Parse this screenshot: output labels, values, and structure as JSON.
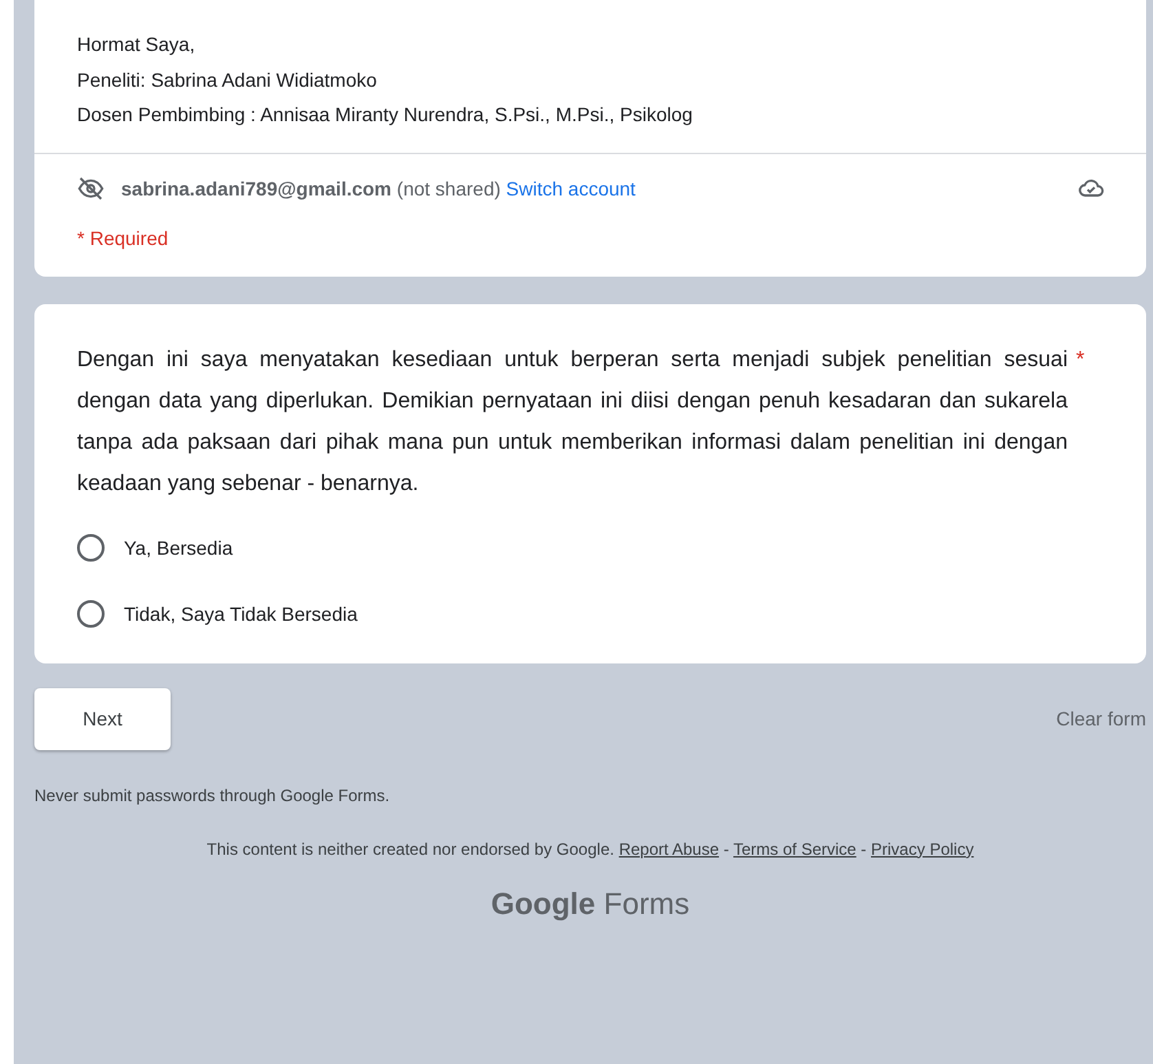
{
  "intro_card": {
    "lines": [
      "Hormat Saya,",
      "Peneliti: Sabrina Adani Widiatmoko",
      "Dosen Pembimbing : Annisaa Miranty Nurendra, S.Psi., M.Psi., Psikolog"
    ],
    "account": {
      "email": "sabrina.adani789@gmail.com",
      "note": "(not shared)",
      "switch_link": "Switch account"
    },
    "required_note": "* Required"
  },
  "question_card": {
    "text": "Dengan ini saya menyatakan kesediaan untuk berperan serta menjadi subjek penelitian sesuai dengan data yang diperlukan.  Demikian pernyataan ini diisi dengan penuh kesadaran dan sukarela tanpa ada paksaan dari pihak mana pun untuk memberikan informasi dalam penelitian ini dengan keadaan yang sebenar - benarnya.",
    "required_mark": "*",
    "options": [
      {
        "label": "Ya, Bersedia",
        "selected": false
      },
      {
        "label": "Tidak, Saya Tidak Bersedia",
        "selected": false
      }
    ]
  },
  "next_button": "Next",
  "clear_button": "Clear form",
  "password_warning": "Never submit passwords through Google Forms.",
  "disclaimer": {
    "text": "This content is neither created nor endorsed by Google.",
    "links": [
      "Report Abuse",
      "Terms of Service",
      "Privacy Policy"
    ],
    "separator": "-"
  },
  "logo": "**Google** Forms"
}
